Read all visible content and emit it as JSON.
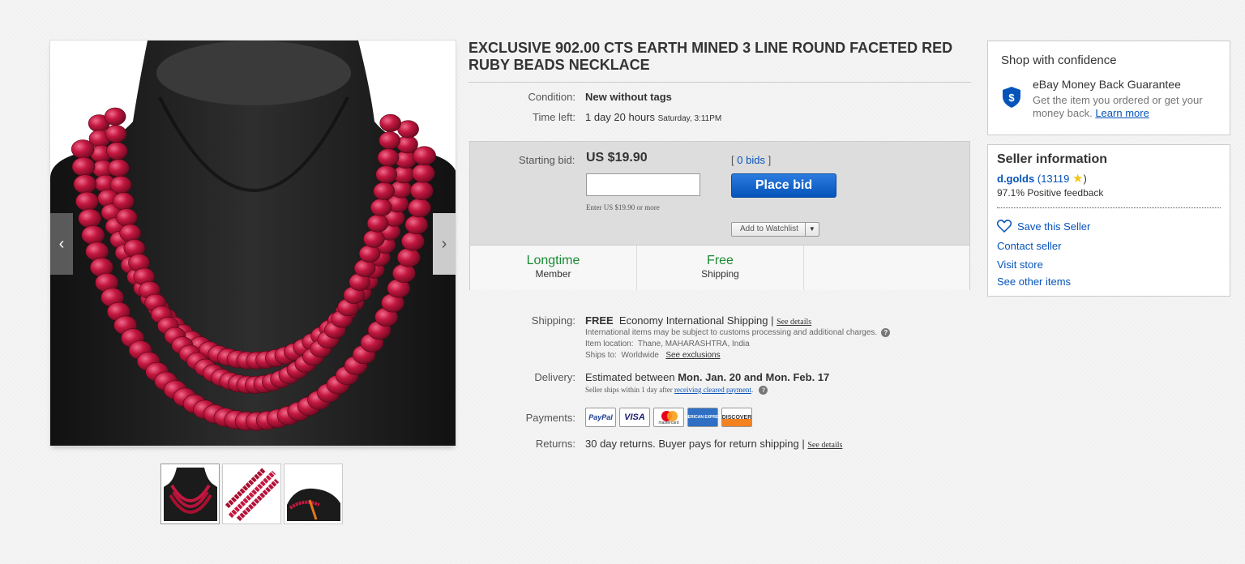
{
  "title": "EXCLUSIVE 902.00 CTS EARTH MINED 3 LINE ROUND FACETED RED RUBY BEADS NECKLACE",
  "gallery": {
    "prev_arrow": "‹",
    "next_arrow": "›",
    "thumbnails": 3
  },
  "condition": {
    "label": "Condition:",
    "value": "New without tags"
  },
  "time_left": {
    "label": "Time left:",
    "value": "1 day 20 hours",
    "ends": "Saturday, 3:11PM"
  },
  "bid": {
    "label": "Starting bid:",
    "price": "US $19.90",
    "input_value": "",
    "hint": "Enter US $19.90 or more",
    "bids_open": "[",
    "bids_count": "0 bids",
    "bids_close": "]",
    "place_bid_label": "Place bid",
    "watchlist_label": "Add to Watchlist",
    "watchlist_caret": "▼"
  },
  "badges": [
    {
      "big": "Longtime",
      "small": "Member"
    },
    {
      "big": "Free",
      "small": "Shipping"
    }
  ],
  "shipping": {
    "label": "Shipping:",
    "free": "FREE",
    "method": "Economy International Shipping |",
    "see_details": "See details",
    "customs_note": "International items may be subject to customs processing and additional charges.",
    "location_label": "Item location:",
    "location": "Thane, MAHARASHTRA, India",
    "ships_to_label": "Ships to:",
    "ships_to": "Worldwide",
    "see_exclusions": "See exclusions",
    "help": "?"
  },
  "delivery": {
    "label": "Delivery:",
    "prefix": "Estimated between",
    "dates": "Mon. Jan. 20 and Mon. Feb. 17",
    "note_prefix": "Seller ships within 1 day after",
    "note_link": "receiving cleared payment",
    "note_suffix": ".",
    "help": "?"
  },
  "payments": {
    "label": "Payments:",
    "methods": [
      "PayPal",
      "VISA",
      "mastercard",
      "AMERICAN EXPRESS",
      "DISCOVER"
    ]
  },
  "returns": {
    "label": "Returns:",
    "value": "30 day returns. Buyer pays for return shipping |",
    "see_details": "See details"
  },
  "confidence": {
    "title": "Shop with confidence",
    "mbg_title": "eBay Money Back Guarantee",
    "mbg_text": "Get the item you ordered or get your money back.",
    "learn_more": "Learn more"
  },
  "seller": {
    "title": "Seller information",
    "name": "d.golds",
    "score_open": "(",
    "score": "13119",
    "score_close": ")",
    "star": "★",
    "feedback": "97.1% Positive feedback",
    "save": "Save this Seller",
    "contact": "Contact seller",
    "store": "Visit store",
    "other": "See other items"
  },
  "colors": {
    "link": "#0654ba",
    "place_bid": "#0654ba",
    "badge_green": "#1a8a34",
    "ruby": "#b3133a"
  }
}
